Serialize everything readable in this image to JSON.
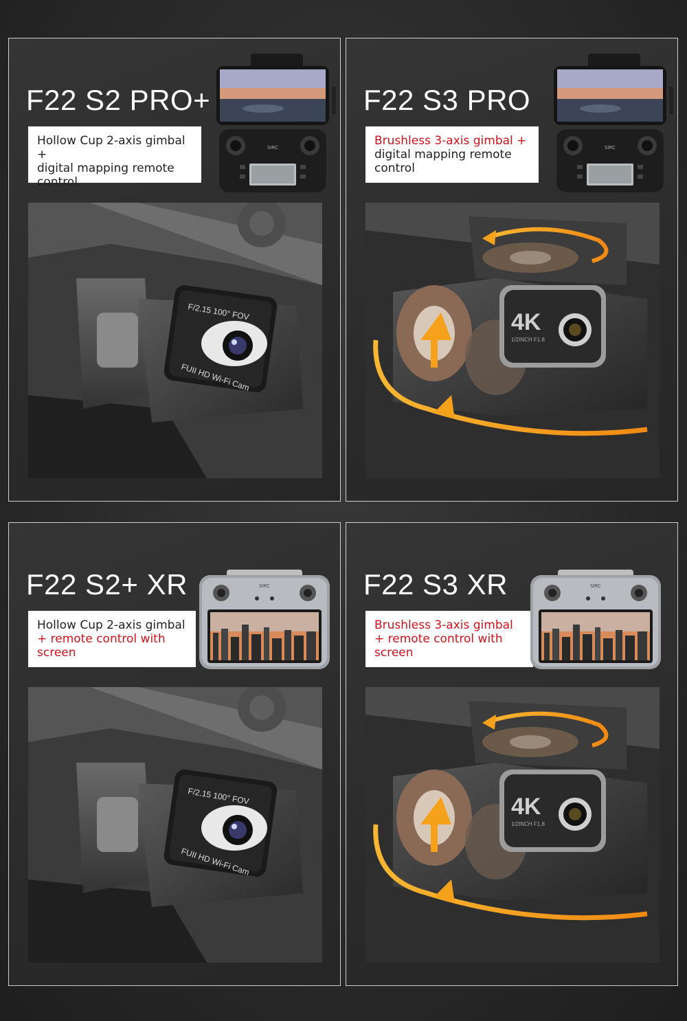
{
  "panels": [
    {
      "title": "F22 S2 PRO+",
      "desc_lines": [
        {
          "text": "Hollow Cup 2-axis gimbal +",
          "color": "#222222"
        },
        {
          "text": "digital mapping remote",
          "color": "#222222"
        },
        {
          "text": "control",
          "color": "#222222"
        }
      ],
      "remote": "digital-mapping-remote",
      "gimbal": "2-axis",
      "camera_label_top": "F/2.15 100° FOV",
      "camera_label_bottom": "FUII HD Wi-Fi Cam"
    },
    {
      "title": "F22 S3 PRO",
      "desc_lines": [
        {
          "text": "Brushless 3-axis gimbal +",
          "color": "#d0121b"
        },
        {
          "text": "digital mapping remote",
          "color": "#222222"
        },
        {
          "text": "control",
          "color": "#222222"
        }
      ],
      "remote": "digital-mapping-remote",
      "gimbal": "3-axis",
      "camera_label_big": "4K",
      "camera_label_small": "1/2INCH  F1.8"
    },
    {
      "title": "F22 S2+ XR",
      "desc_lines": [
        {
          "text": "Hollow Cup 2-axis gimbal",
          "color": "#222222"
        },
        {
          "text": "+ remote control with",
          "color": "#d0121b"
        },
        {
          "text": "screen",
          "color": "#d0121b"
        }
      ],
      "remote": "screen-remote",
      "gimbal": "2-axis",
      "camera_label_top": "F/2.15 100° FOV",
      "camera_label_bottom": "FUII HD Wi-Fi Cam"
    },
    {
      "title": "F22 S3 XR",
      "desc_lines": [
        {
          "text": "Brushless 3-axis gimbal",
          "color": "#d0121b"
        },
        {
          "text": "+ remote control with",
          "color": "#d0121b"
        },
        {
          "text": "screen",
          "color": "#d0121b"
        }
      ],
      "remote": "screen-remote",
      "gimbal": "3-axis",
      "camera_label_big": "4K",
      "camera_label_small": "1/2INCH  F1.8"
    }
  ],
  "remote_brand": "SIRC",
  "colors": {
    "accent_red": "#d0121b",
    "arrow_orange": "#f5a11c",
    "panel_border": "#cfcfcf"
  }
}
